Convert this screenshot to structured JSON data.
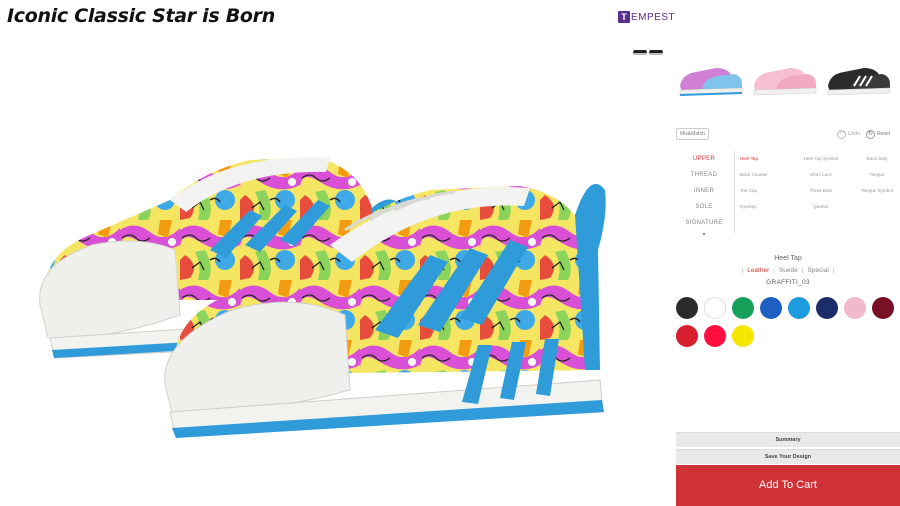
{
  "page": {
    "title": "Iconic Classic Star is Born"
  },
  "brand": {
    "logo_letter": "T",
    "logo_text": "EMPEST"
  },
  "toolbar": {
    "mixmatch": "Mix&Match",
    "undo": "Undo",
    "reset": "Reset"
  },
  "categories": [
    {
      "label": "UPPER",
      "active": true
    },
    {
      "label": "THREAD",
      "active": false
    },
    {
      "label": "INNER",
      "active": false
    },
    {
      "label": "SOLE",
      "active": false
    },
    {
      "label": "SIGNATURE",
      "active": false
    }
  ],
  "parts": [
    {
      "label": "Heel Tap",
      "active": true
    },
    {
      "label": "Heel Tap Symbol",
      "active": false
    },
    {
      "label": "Back Stay",
      "active": false
    },
    {
      "label": "Back Counter",
      "active": false
    },
    {
      "label": "Shoe Lace",
      "active": false
    },
    {
      "label": "Tongue",
      "active": false
    },
    {
      "label": "Toe Cap",
      "active": false
    },
    {
      "label": "Three Bars",
      "active": false
    },
    {
      "label": "Tongue Symbol",
      "active": false
    },
    {
      "label": "Eyestay",
      "active": false
    },
    {
      "label": "Quarter",
      "active": false
    },
    {
      "label": "",
      "active": false
    }
  ],
  "material": {
    "title": "Heel Tap",
    "tabs": [
      {
        "label": "Leather",
        "active": true
      },
      {
        "label": "Suede",
        "active": false
      },
      {
        "label": "Special",
        "active": false
      }
    ],
    "pattern_name": "GRAFFITI_03"
  },
  "swatches": [
    "#2b2b2b",
    "#ffffff",
    "#16a05a",
    "#1d5fc2",
    "#1e9ade",
    "#1b2d6b",
    "#f1b8ce",
    "#7a1028",
    "#d81f2f",
    "#ff0f3f",
    "#f7e600"
  ],
  "actions": {
    "summary": "Summary",
    "save": "Save Your Design",
    "add_to_cart": "Add To Cart"
  },
  "colors": {
    "accent_red": "#cf3236",
    "active_red": "#dd3333",
    "shoe_blue": "#2f9bd9"
  }
}
